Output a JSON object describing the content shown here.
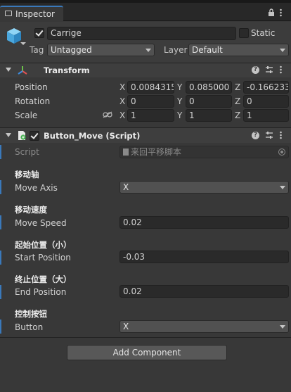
{
  "tab": {
    "label": "Inspector"
  },
  "object": {
    "name": "Carrige",
    "static_label": "Static",
    "tag_label": "Tag",
    "tag_value": "Untagged",
    "layer_label": "Layer",
    "layer_value": "Default"
  },
  "transform": {
    "title": "Transform",
    "position": {
      "label": "Position",
      "x": "0.0084315",
      "y": "0.085000",
      "z": "-0.166233"
    },
    "rotation": {
      "label": "Rotation",
      "x": "0",
      "y": "0",
      "z": "0"
    },
    "scale": {
      "label": "Scale",
      "x": "1",
      "y": "1",
      "z": "1"
    },
    "axes": {
      "x": "X",
      "y": "Y",
      "z": "Z"
    }
  },
  "script_component": {
    "title": "Button_Move (Script)",
    "script_label": "Script",
    "script_value": "来回平移脚本",
    "fields": [
      {
        "header": "移动轴",
        "label": "Move Axis",
        "value": "X",
        "type": "dropdown"
      },
      {
        "header": "移动速度",
        "label": "Move Speed",
        "value": "0.02",
        "type": "text"
      },
      {
        "header": "起始位置（小）",
        "label": "Start Position",
        "value": "-0.03",
        "type": "text"
      },
      {
        "header": "终止位置（大）",
        "label": "End Position",
        "value": "0.02",
        "type": "text"
      },
      {
        "header": "控制按钮",
        "label": "Button",
        "value": "X",
        "type": "dropdown"
      }
    ]
  },
  "add_component": {
    "label": "Add Component"
  },
  "colors": {
    "background": "#383838",
    "header": "#3e3e3e",
    "field": "#2a2a2a",
    "accent": "#3a79bb"
  },
  "icons": {
    "lock": "lock-icon",
    "menu": "menu-icon",
    "help": "help-icon",
    "preset": "preset-icon",
    "more": "more-icon"
  }
}
